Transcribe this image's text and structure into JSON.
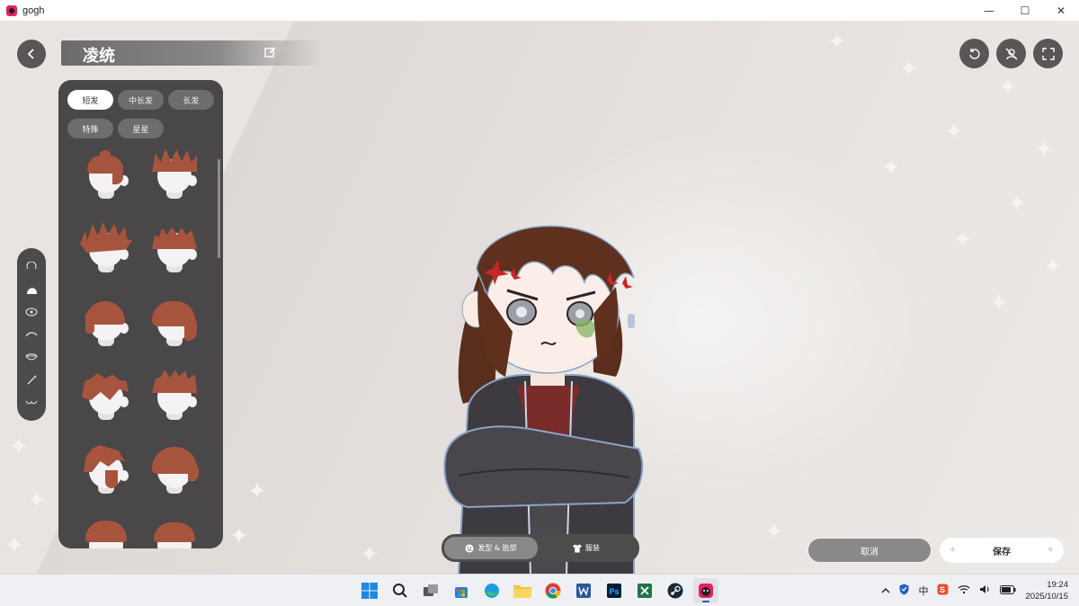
{
  "window": {
    "title": "gogh",
    "controls": {
      "minimize": "—",
      "maximize": "☐",
      "close": "✕"
    }
  },
  "header": {
    "back_icon": "chevron-left-icon",
    "character_name": "凌统",
    "edit_icon": "edit-icon",
    "top_icons": [
      "undo-icon",
      "hide-avatar-icon",
      "fullscreen-icon"
    ]
  },
  "side_tools": [
    "hair-rotate-icon",
    "hairstyle-icon",
    "eye-icon",
    "eyebrow-icon",
    "mouth-icon",
    "magic-wand-icon",
    "mustache-icon"
  ],
  "hair_panel": {
    "categories": [
      "短发",
      "中长发",
      "长发",
      "特殊",
      "星星"
    ],
    "selected_category": "短发",
    "hair_color": "#a7543e"
  },
  "bottom_tabs": [
    {
      "label": "发型 & 脸部",
      "icon": "face-icon",
      "active": true
    },
    {
      "label": "服装",
      "icon": "shirt-icon",
      "active": false
    }
  ],
  "actions": {
    "cancel_label": "取消",
    "save_label": "保存"
  },
  "taskbar": {
    "apps": [
      "windows-start-icon",
      "search-icon",
      "task-view-icon",
      "store-icon",
      "edge-icon",
      "file-explorer-icon",
      "chrome-icon",
      "word-icon",
      "photoshop-icon",
      "excel-icon",
      "steam-icon",
      "gogh-app-icon"
    ],
    "tray": {
      "ime": "中",
      "time": "19:24",
      "date": "2025/10/15"
    }
  },
  "colors": {
    "panel_bg": "#4a4748",
    "accent_red": "#e0245e",
    "hair_brown": "#a7543e"
  }
}
